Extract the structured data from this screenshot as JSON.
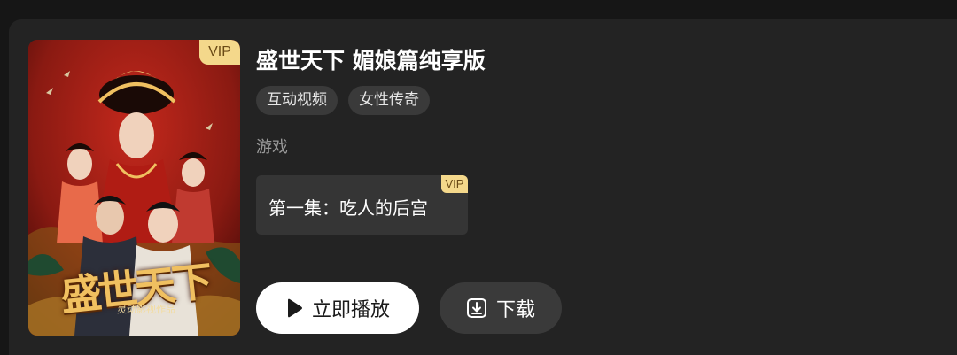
{
  "poster": {
    "vip_badge": "VIP",
    "title_art": "盛世天下",
    "studio_art": "灵动影视作品"
  },
  "show": {
    "title": "盛世天下 媚娘篇纯享版",
    "tags": [
      "互动视频",
      "女性传奇"
    ],
    "category": "游戏"
  },
  "episode": {
    "label": "第一集：吃人的后宫",
    "vip_badge": "VIP"
  },
  "actions": {
    "play_label": "立即播放",
    "play_icon": "play-icon",
    "download_label": "下载",
    "download_icon": "download-icon"
  },
  "colors": {
    "background": "#161616",
    "card": "#232323",
    "tag_bg": "#3a3a3a",
    "vip_gold": "#f4d88b",
    "poster_red": "#7a1410"
  }
}
